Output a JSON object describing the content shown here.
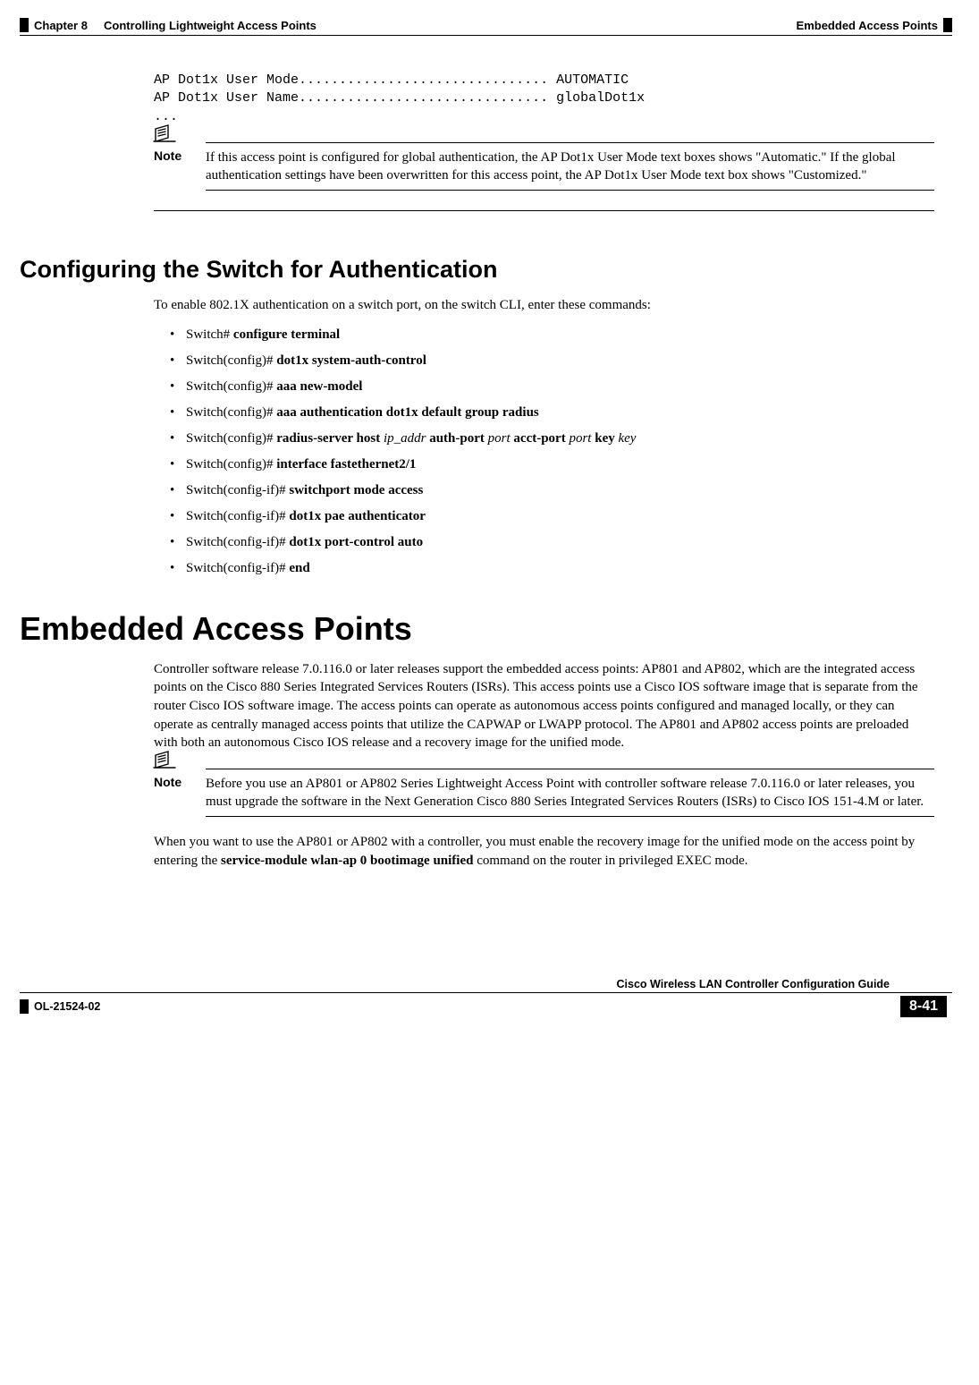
{
  "header": {
    "chapter_label": "Chapter 8",
    "chapter_title": "Controlling Lightweight Access Points",
    "running_head_right": "Embedded Access Points"
  },
  "code_block": "AP Dot1x User Mode............................... AUTOMATIC\nAP Dot1x User Name............................... globalDot1x\n...",
  "note1": {
    "label": "Note",
    "text": "If this access point is configured for global authentication, the AP Dot1x User Mode text boxes shows \"Automatic.\" If the global authentication settings have been overwritten for this access point, the AP Dot1x User Mode text box shows \"Customized.\""
  },
  "section2": {
    "title": "Configuring the Switch for Authentication",
    "intro": "To enable 802.1X authentication on a switch port, on the switch CLI, enter these commands:",
    "commands": [
      {
        "prompt": "Switch# ",
        "bold": "configure terminal"
      },
      {
        "prompt": "Switch(config)# ",
        "bold": "dot1x system-auth-control"
      },
      {
        "prompt": "Switch(config)# ",
        "bold": "aaa new-model"
      },
      {
        "prompt": "Switch(config)# ",
        "bold": "aaa authentication dot1x default group radius"
      },
      {
        "prompt": "Switch(config)# ",
        "bold1": "radius-server host ",
        "it1": "ip_addr",
        "bold2": " auth-port ",
        "it2": "port",
        "bold3": " acct-port ",
        "it3": "port",
        "bold4": " key ",
        "it4": "key"
      },
      {
        "prompt": "Switch(config)# ",
        "bold": "interface fastethernet2/1"
      },
      {
        "prompt": "Switch(config-if)# ",
        "bold": "switchport mode access"
      },
      {
        "prompt": "Switch(config-if)# ",
        "bold": "dot1x pae authenticator"
      },
      {
        "prompt": "Switch(config-if)# ",
        "bold": "dot1x port-control auto"
      },
      {
        "prompt": "Switch(config-if)# ",
        "bold": "end"
      }
    ]
  },
  "section3": {
    "title": "Embedded Access Points",
    "para1": "Controller software release 7.0.116.0 or later releases support the embedded access points: AP801 and AP802, which are the integrated access points on the Cisco 880 Series Integrated Services Routers (ISRs). This access points use a Cisco IOS software image that is separate from the router Cisco IOS software image. The access points can operate as autonomous access points configured and managed locally, or they can operate as centrally managed access points that utilize the CAPWAP or LWAPP protocol. The AP801 and AP802 access points are preloaded with both an autonomous Cisco IOS release and a recovery image for the unified mode."
  },
  "note2": {
    "label": "Note",
    "text": "Before you use an AP801 or AP802 Series Lightweight Access Point with controller software release 7.0.116.0 or later releases, you must upgrade the software in the Next Generation Cisco 880 Series Integrated Services Routers (ISRs) to Cisco IOS 151-4.M or later."
  },
  "para_after_note2": {
    "pre": "When you want to use the AP801 or AP802 with a controller, you must enable the recovery image for the unified mode on the access point by entering the ",
    "bold": "service-module wlan-ap 0 bootimage unified",
    "post": " command on the router in privileged EXEC mode."
  },
  "footer": {
    "guide": "Cisco Wireless LAN Controller Configuration Guide",
    "doc_id": "OL-21524-02",
    "page_num": "8-41"
  }
}
